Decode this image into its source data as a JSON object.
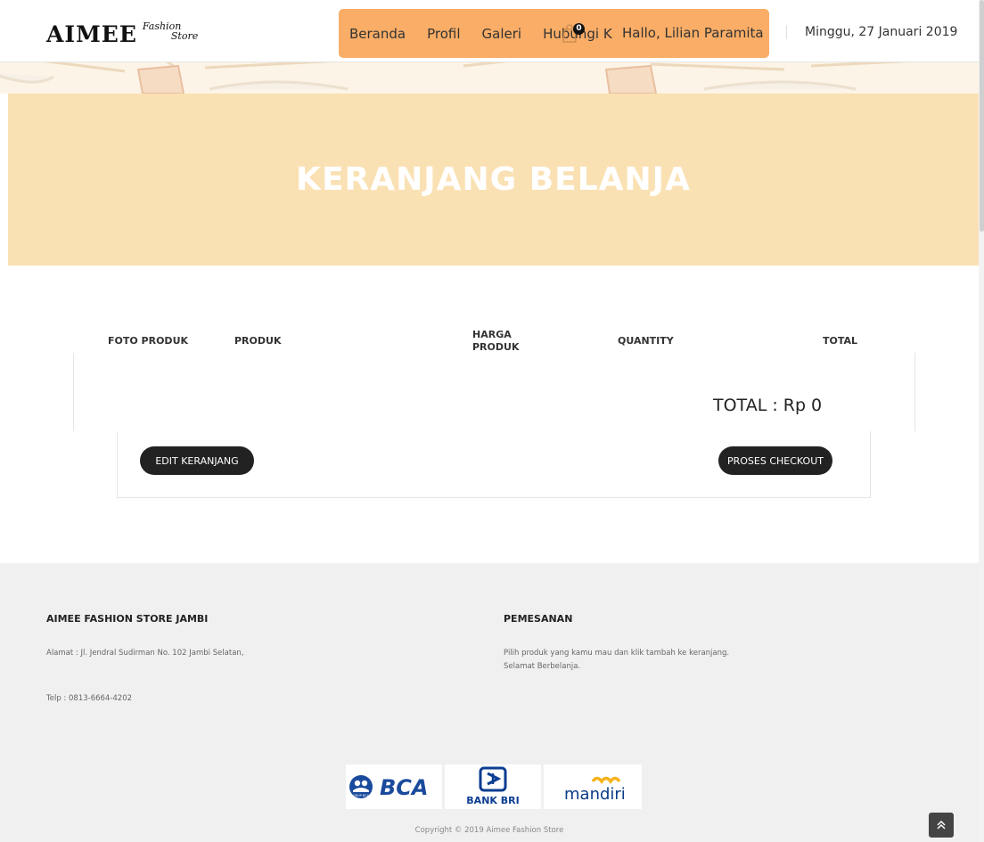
{
  "header": {
    "logo_main": "AIMEE",
    "logo_line1": "Fashion",
    "logo_line2": "Store",
    "nav": [
      "Beranda",
      "Profil",
      "Galeri",
      "Hubungi K"
    ],
    "greeting": "Hallo, Lilian Paramita",
    "cart_count": "0",
    "date": "Minggu, 27 Januari 2019"
  },
  "banner": {
    "title": "KERANJANG BELANJA"
  },
  "cart": {
    "columns": [
      "FOTO PRODUK",
      "PRODUK",
      "HARGA PRODUK",
      "QUANTITY",
      "TOTAL"
    ],
    "harga_line1": "HARGA",
    "harga_line2": "PRODUK",
    "total_text": "TOTAL : Rp 0",
    "edit_button": "EDIT KERANJANG",
    "checkout_button": "PROSES CHECKOUT"
  },
  "footer": {
    "store_title": "AIMEE FASHION STORE JAMBI",
    "address": "Alamat : Jl. Jendral Sudirman No. 102 Jambi Selatan,",
    "phone": "Telp : 0813-6664-4202",
    "order_title": "PEMESANAN",
    "order_line1": "Pilih produk yang kamu mau dan klik tambah ke keranjang.",
    "order_line2": "Selamat Berbelanja.",
    "banks": {
      "bca": "BCA",
      "bca_seal": "GRUP BCA",
      "bri": "BANK BRI",
      "mandiri": "mandiri"
    },
    "copyright": "Copyright © 2019 Aimee Fashion Store"
  },
  "colors": {
    "nav_bg": "#f9ad66",
    "banner_bg": "#fae1b4",
    "button_bg": "#222222",
    "bca_blue": "#1a4a9c",
    "mandiri_blue": "#0a3b86",
    "mandiri_gold": "#f6b21a"
  },
  "icons": [
    "shopping-bag-icon",
    "double-chevron-up-icon"
  ]
}
